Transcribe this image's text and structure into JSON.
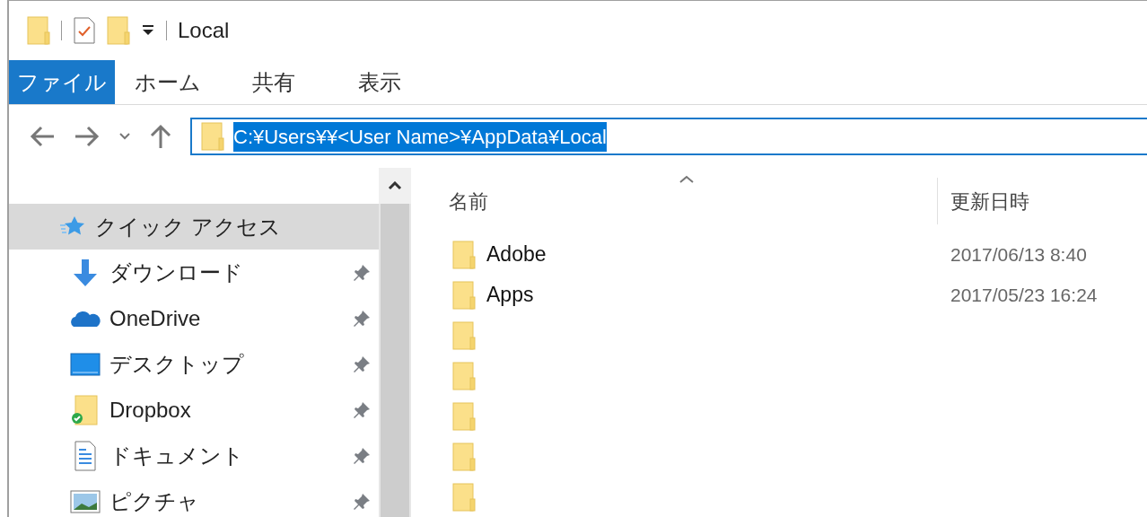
{
  "window": {
    "title": "Local"
  },
  "ribbon_tabs": [
    {
      "label": "ファイル",
      "selected": true
    },
    {
      "label": "ホーム",
      "selected": false
    },
    {
      "label": "共有",
      "selected": false
    },
    {
      "label": "表示",
      "selected": false
    }
  ],
  "address": {
    "value": "C:¥Users¥¥<User Name>¥AppData¥Local",
    "selected": true
  },
  "sidebar": {
    "items": [
      {
        "label": "クイック アクセス",
        "kind": "star",
        "selected": true,
        "pinned": false
      },
      {
        "label": "ダウンロード",
        "kind": "download",
        "selected": false,
        "pinned": true
      },
      {
        "label": "OneDrive",
        "kind": "cloud",
        "selected": false,
        "pinned": true
      },
      {
        "label": "デスクトップ",
        "kind": "desktop",
        "selected": false,
        "pinned": true
      },
      {
        "label": "Dropbox",
        "kind": "synced-folder",
        "selected": false,
        "pinned": true
      },
      {
        "label": "ドキュメント",
        "kind": "document",
        "selected": false,
        "pinned": true
      },
      {
        "label": "ピクチャ",
        "kind": "picture",
        "selected": false,
        "pinned": true
      }
    ]
  },
  "file_list": {
    "columns": [
      "名前",
      "更新日時"
    ],
    "rows": [
      {
        "name": "Adobe",
        "modified": "2017/06/13 8:40"
      },
      {
        "name": "Apps",
        "modified": "2017/05/23 16:24"
      },
      {},
      {},
      {},
      {},
      {}
    ]
  }
}
